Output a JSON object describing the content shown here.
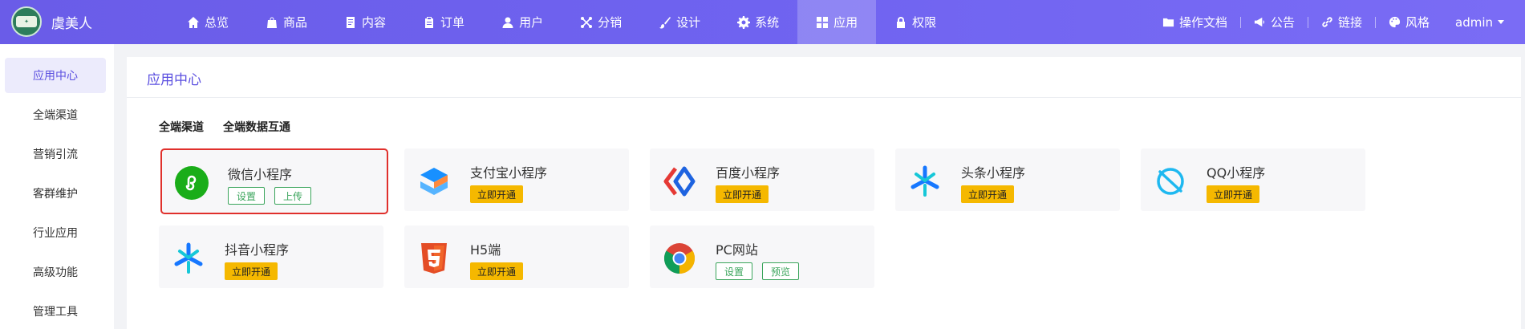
{
  "header": {
    "brand": "虞美人",
    "nav": [
      {
        "label": "总览",
        "icon": "home-icon"
      },
      {
        "label": "商品",
        "icon": "bag-icon"
      },
      {
        "label": "内容",
        "icon": "document-icon"
      },
      {
        "label": "订单",
        "icon": "clipboard-icon"
      },
      {
        "label": "用户",
        "icon": "user-icon"
      },
      {
        "label": "分销",
        "icon": "share-nodes-icon"
      },
      {
        "label": "设计",
        "icon": "brush-icon"
      },
      {
        "label": "系统",
        "icon": "gear-icon"
      },
      {
        "label": "应用",
        "icon": "grid-icon"
      },
      {
        "label": "权限",
        "icon": "lock-icon"
      }
    ],
    "active_nav": "应用",
    "right": {
      "docs": "操作文档",
      "notice": "公告",
      "links": "链接",
      "style": "风格",
      "user": "admin"
    }
  },
  "sidebar": {
    "items": [
      "应用中心",
      "全端渠道",
      "营销引流",
      "客群维护",
      "行业应用",
      "高级功能",
      "管理工具"
    ],
    "active": "应用中心"
  },
  "main": {
    "title": "应用中心",
    "tabs": [
      "全端渠道",
      "全端数据互通"
    ],
    "cards": [
      {
        "name": "微信小程序",
        "icon": "wechat-miniprogram-icon",
        "buttons": [
          "设置",
          "上传"
        ],
        "style": "outline"
      },
      {
        "name": "支付宝小程序",
        "icon": "alipay-miniprogram-icon",
        "buttons": [
          "立即开通"
        ],
        "style": "yellow"
      },
      {
        "name": "百度小程序",
        "icon": "baidu-miniprogram-icon",
        "buttons": [
          "立即开通"
        ],
        "style": "yellow"
      },
      {
        "name": "头条小程序",
        "icon": "toutiao-miniprogram-icon",
        "buttons": [
          "立即开通"
        ],
        "style": "yellow"
      },
      {
        "name": "QQ小程序",
        "icon": "qq-miniprogram-icon",
        "buttons": [
          "立即开通"
        ],
        "style": "yellow"
      },
      {
        "name": "抖音小程序",
        "icon": "douyin-miniprogram-icon",
        "buttons": [
          "立即开通"
        ],
        "style": "yellow"
      },
      {
        "name": "H5端",
        "icon": "html5-icon",
        "buttons": [
          "立即开通"
        ],
        "style": "yellow"
      },
      {
        "name": "PC网站",
        "icon": "chrome-icon",
        "buttons": [
          "设置",
          "预览"
        ],
        "style": "outline"
      }
    ]
  },
  "colors": {
    "header_start": "#6a5ce8",
    "header_end": "#7a6cf5",
    "accent": "#5b4fe0",
    "yellow_button": "#f5b800",
    "green_outline": "#3ba55c",
    "highlight_border": "#e0302c"
  }
}
